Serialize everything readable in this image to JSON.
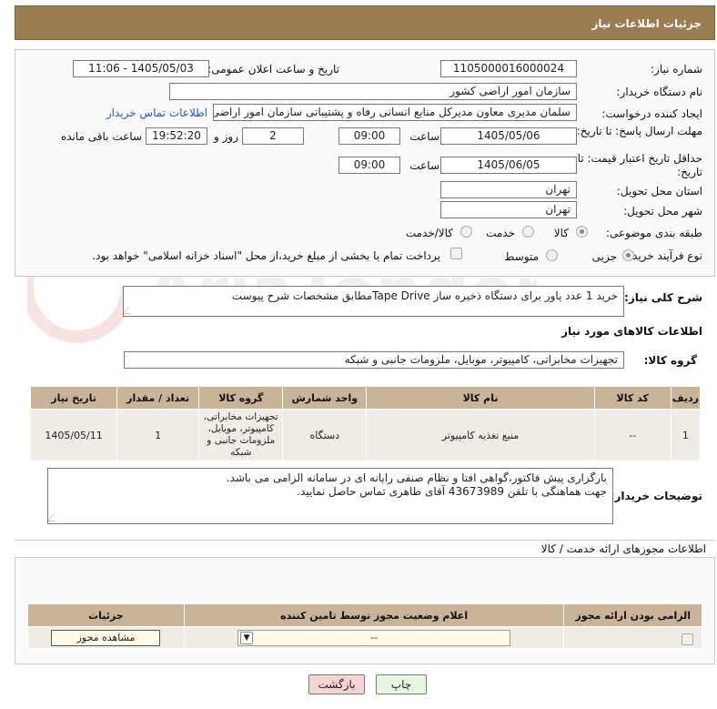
{
  "header": {
    "title": "جزئیات اطلاعات نیاز"
  },
  "fields": {
    "need_number_label": "شماره نیاز:",
    "need_number": "1105000016000024",
    "announce_label": "تاریخ و ساعت اعلان عمومی:",
    "announce_value": "1405/05/03 - 11:06",
    "buyer_org_label": "نام دستگاه خریدار:",
    "buyer_org": "سازمان امور اراضی کشور",
    "creator_label": "ایجاد کننده درخواست:",
    "creator": "سلمان مدیری معاون مدیرکل منابع انسانی رفاه و پشتیبانی سازمان امور اراضی",
    "buyer_contact_link": "اطلاعات تماس خریدار",
    "reply_deadline_label": "مهلت ارسال پاسخ: تا تاریخ:",
    "reply_date": "1405/05/06",
    "time_label": "ساعت",
    "reply_time": "09:00",
    "days_value": "2",
    "days_label": "روز و",
    "remaining_time": "19:52:20",
    "remaining_label": "ساعت باقی مانده",
    "price_deadline_label": "حداقل تاریخ اعتبار قیمت: تا تاریخ:",
    "price_date": "1405/06/05",
    "price_time": "09:00",
    "province_label": "استان محل تحویل:",
    "province": "تهران",
    "city_label": "شهر محل تحویل:",
    "city": "تهران",
    "category_label": "طبقه بندی موضوعی:",
    "category_options": [
      "کالا",
      "خدمت",
      "کالا/خدمت"
    ],
    "process_label": "نوع فرآیند خرید :",
    "process_options": [
      "جزیی",
      "متوسط"
    ],
    "payment_note": "پرداخت تمام یا بخشی از مبلغ خرید،از محل \"اسناد خزانه اسلامی\" خواهد بود."
  },
  "description": {
    "label": "شرح کلی نیاز:",
    "text": "خرید 1 عدد پاور برای دستگاه ذخیره ساز Tape Driveمطابق مشخصات شرح پیوست"
  },
  "goods": {
    "section_title": "اطلاعات کالاهای مورد نیاز",
    "group_label": "گروه کالا:",
    "group_value": "تجهیزات مخابراتی، کامپیوتر، موبایل، ملزومات جانبی و شبکه",
    "columns": [
      "ردیف",
      "کد کالا",
      "نام کالا",
      "واحد شمارش",
      "گروه کالا",
      "تعداد / مقدار",
      "تاریخ نیاز"
    ],
    "rows": [
      {
        "row": "1",
        "code": "--",
        "name": "منبع تغذیه کامپیوتر",
        "unit": "دستگاه",
        "group": "تجهیزات مخابراتی، کامپیوتر، موبایل، ملزومات جانبی و شبکه",
        "qty": "1",
        "date": "1405/05/11"
      }
    ]
  },
  "buyer_notes": {
    "label": "توضیحات خریدار:",
    "line1": "بارگزاری پیش فاکتور،گواهی افتا و نظام صنفی رایانه ای در سامانه الزامی می باشد.",
    "line2": "جهت هماهنگی با تلفن 43673989 آقای طاهری تماس حاصل نمایید."
  },
  "permits": {
    "title": "اطلاعات مجوزهای ارائه خدمت / کالا",
    "columns": [
      "الزامی بودن ارائه مجوز",
      "اعلام وضعیت مجوز توسط تامین کننده",
      "جزئیات"
    ],
    "select_value": "--",
    "view_button": "مشاهده مجوز"
  },
  "buttons": {
    "print": "چاپ",
    "back": "بازگشت"
  },
  "watermark": {
    "text": "AriaTender.neT"
  },
  "colors": {
    "header_bg": "#9c7d52",
    "table_header": "#c9b49a",
    "row_bg": "#f1ece6",
    "link": "#2255cc",
    "back_btn": "#f7d4d4",
    "print_btn": "#e6f6e0"
  }
}
